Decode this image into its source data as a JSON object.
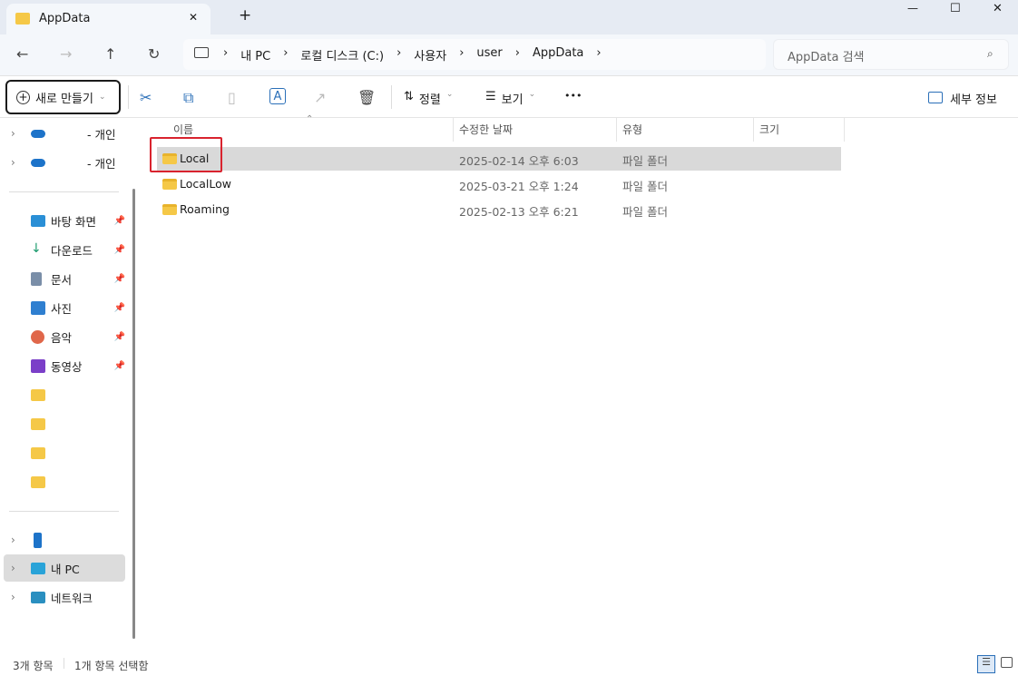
{
  "window": {
    "tab_title": "AppData",
    "min": "—",
    "max": "☐",
    "close": "✕",
    "new_tab": "+",
    "tab_close": "✕"
  },
  "nav": {
    "back": "←",
    "forward": "→",
    "up": "↑",
    "refresh": "↻",
    "sep": "›",
    "breadcrumb": [
      "내 PC",
      "로컬 디스크 (C:)",
      "사용자",
      "user",
      "AppData"
    ],
    "search_placeholder": "AppData 검색"
  },
  "toolbar": {
    "new": "새로 만들기",
    "sort": "정렬",
    "view": "보기",
    "more": "•••",
    "details": "세부 정보"
  },
  "sidebar": {
    "cloud": [
      "- 개인",
      "- 개인"
    ],
    "quick": [
      {
        "label": "바탕 화면",
        "color": "#2a8fd6"
      },
      {
        "label": "다운로드",
        "color": "#1a9a6c"
      },
      {
        "label": "문서",
        "color": "#7a8ea8"
      },
      {
        "label": "사진",
        "color": "#2f7fd0"
      },
      {
        "label": "음악",
        "color": "#e0674a"
      },
      {
        "label": "동영상",
        "color": "#7b3fc8"
      }
    ],
    "pc": "내 PC",
    "network": "네트워크"
  },
  "columns": {
    "name": "이름",
    "date": "수정한 날짜",
    "type": "유형",
    "size": "크기"
  },
  "files": [
    {
      "name": "Local",
      "date": "2025-02-14 오후 6:03",
      "type": "파일 폴더"
    },
    {
      "name": "LocalLow",
      "date": "2025-03-21 오후 1:24",
      "type": "파일 폴더"
    },
    {
      "name": "Roaming",
      "date": "2025-02-13 오후 6:21",
      "type": "파일 폴더"
    }
  ],
  "status": {
    "count": "3개 항목",
    "selected": "1개 항목 선택함"
  }
}
